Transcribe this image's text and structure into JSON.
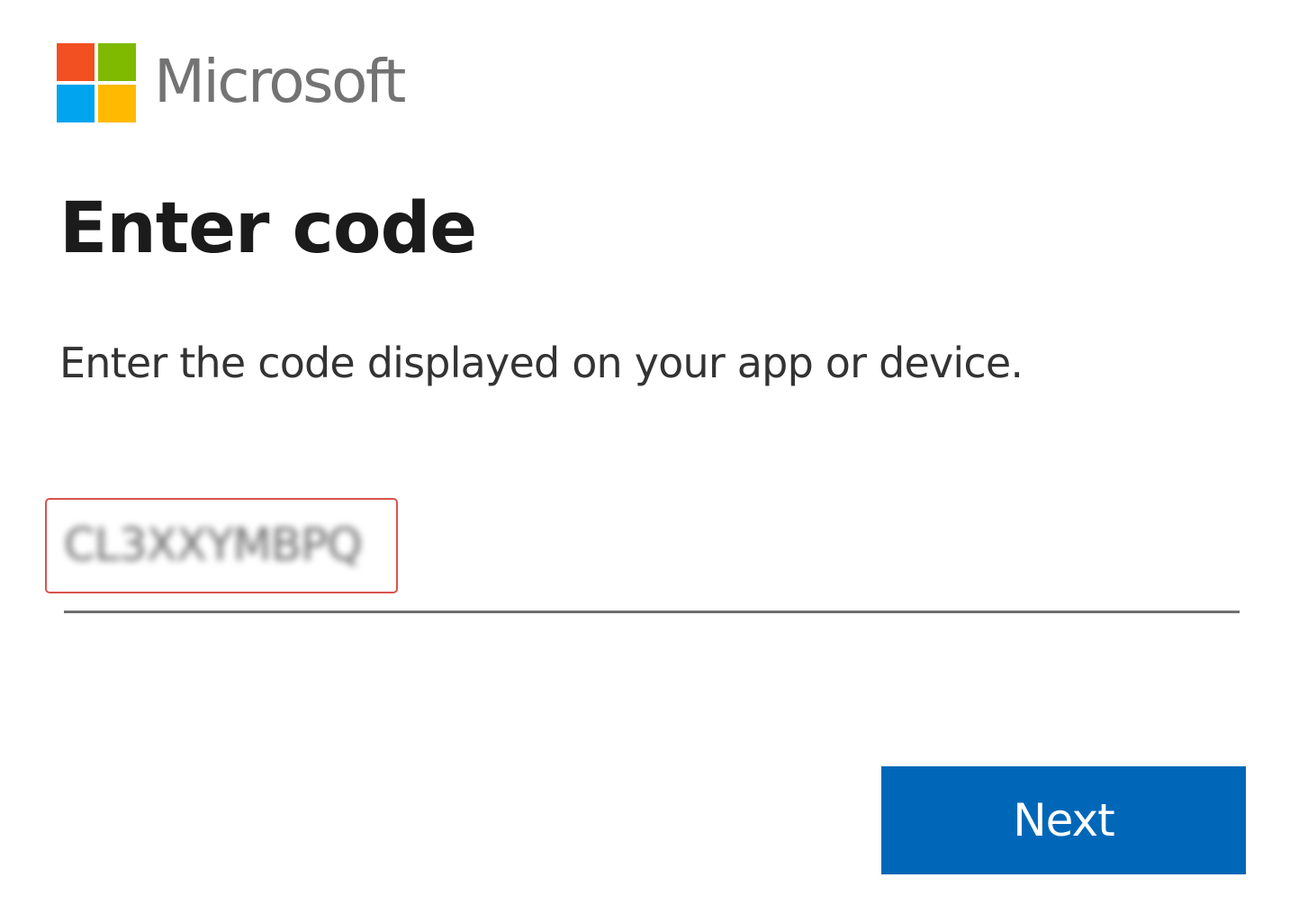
{
  "brand": {
    "name": "Microsoft",
    "logo_colors": [
      "#f25022",
      "#7fba00",
      "#00a4ef",
      "#ffb900"
    ]
  },
  "page_title": "Enter code",
  "description": "Enter the code displayed on your app or device.",
  "code_input": {
    "value": "CL3XXYMBPQ",
    "blurred": true
  },
  "next_button_label": "Next",
  "colors": {
    "accent": "#0067b8",
    "highlight_border": "#d9534f",
    "title_text": "#1b1b1b",
    "brand_text": "#737373"
  }
}
